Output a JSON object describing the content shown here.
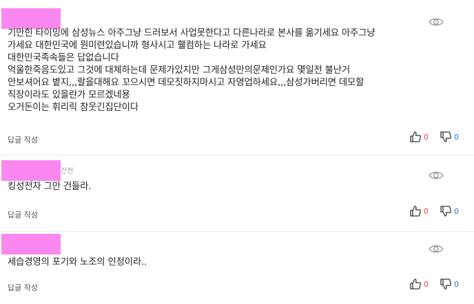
{
  "comments": [
    {
      "time": "",
      "text": "기만힌 타이밍에 삼성뉴스 아주그냥 드러보서 사업못한다고 다른나라로 본사를 옮기세요 아주그냥\n가세요 대한민국에 뭔미련있습니까 형사시고 휄컴하는 나라로 가세요\n대한민국족속들은 답없습니다\n억울한죽음도있고 그것에 대체하는데 문제가있지만 그게삼성만의문제인가요 몇일전 불난거\n안보셔어요 볕지,,,랄을대해요 꼬으시면 데모짓하지마시고 자영업하세요,,,삼성가버리면 데모할\n직장이라도 있을란가 모르겠네용\n오거돈이는 휘리릭 참웃긴집단이다",
      "reply": "답글 작성",
      "likes": "0",
      "dislikes": "0"
    },
    {
      "time": "간전",
      "text": "킹성전자 그만 건들라.",
      "reply": "답글 작성",
      "likes": "0",
      "dislikes": "0"
    },
    {
      "time": "",
      "text": "세습경영의 포기와 노조의 인정이라..",
      "reply": "답글 작성",
      "likes": "0",
      "dislikes": "0"
    }
  ],
  "icons": {
    "view": "eye-icon",
    "like": "thumbs-up-icon",
    "dislike": "thumbs-down-icon"
  },
  "colors": {
    "like_count": "#e54545",
    "dislike_count": "#2a6fd6",
    "redaction": "#fb88f0"
  }
}
